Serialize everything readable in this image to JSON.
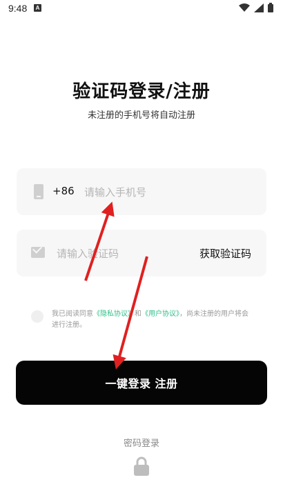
{
  "status_bar": {
    "time": "9:48",
    "badge": "A"
  },
  "header": {
    "title": "验证码登录/注册",
    "subtitle": "未注册的手机号将自动注册"
  },
  "phone_field": {
    "country_code": "+86",
    "placeholder": "请输入手机号",
    "value": ""
  },
  "code_field": {
    "placeholder": "请输入验证码",
    "value": "",
    "get_code_label": "获取验证码"
  },
  "agreement": {
    "prefix": "我已阅读同意",
    "privacy_link": "《隐私协议》",
    "and": "和",
    "user_link": "《用户协议》",
    "suffix": "，尚未注册的用户将会进行注册。",
    "checked": false
  },
  "login_button": {
    "label": "一键登录 注册"
  },
  "password_login": {
    "label": "密码登录"
  },
  "colors": {
    "accent_link": "#2fc08a",
    "button_bg": "#050505",
    "annotation_arrow": "#e02020"
  },
  "icons": [
    "phone-icon",
    "mail-icon",
    "lock-icon",
    "wifi-icon",
    "signal-icon",
    "battery-icon"
  ]
}
